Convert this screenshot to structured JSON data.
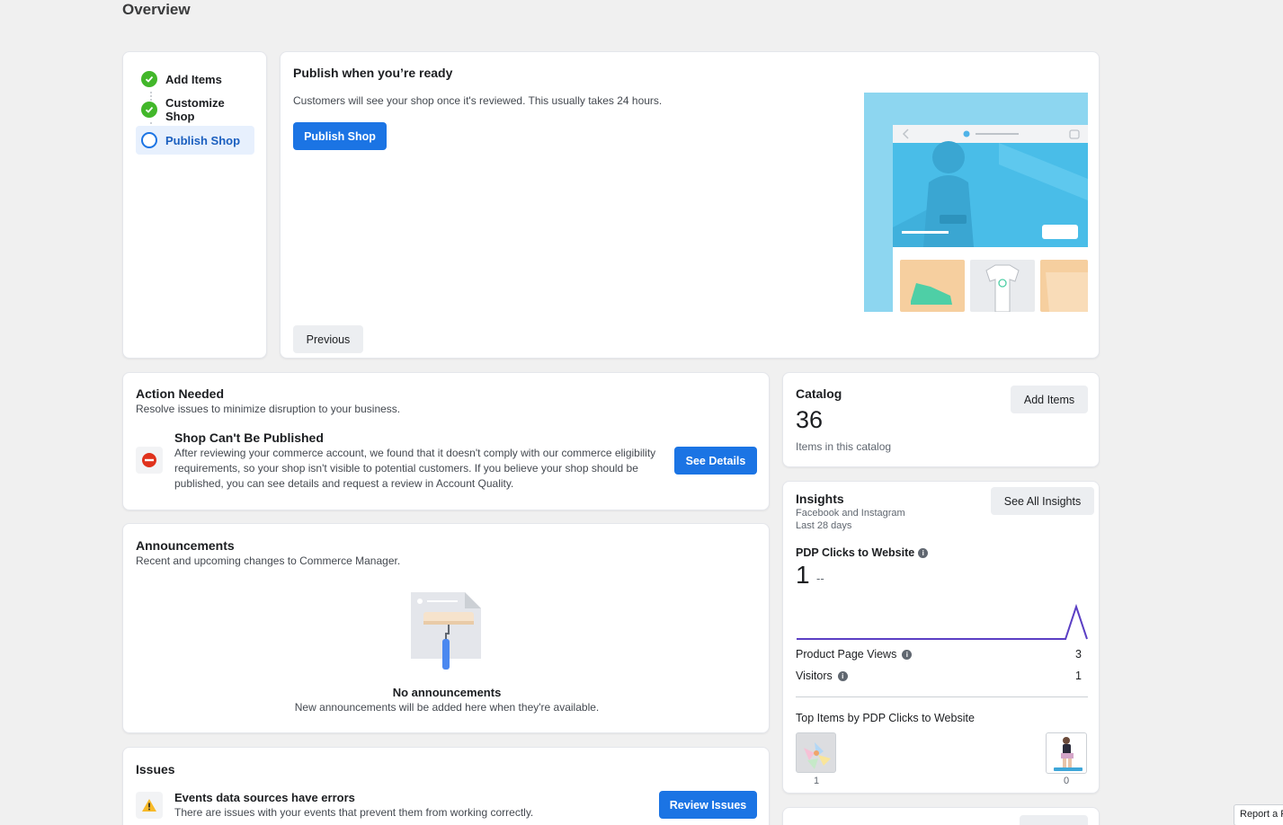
{
  "page": {
    "title": "Overview"
  },
  "steps": [
    {
      "label": "Add Items",
      "status": "done"
    },
    {
      "label": "Customize Shop",
      "status": "done"
    },
    {
      "label": "Publish Shop",
      "status": "active"
    }
  ],
  "publish": {
    "title": "Publish when you’re ready",
    "description": "Customers will see your shop once it's reviewed. This usually takes 24 hours.",
    "publish_button": "Publish Shop",
    "previous_button": "Previous"
  },
  "action_needed": {
    "title": "Action Needed",
    "subtitle": "Resolve issues to minimize disruption to your business.",
    "issue_title": "Shop Can't Be Published",
    "issue_text": "After reviewing your commerce account, we found that it doesn't comply with our commerce eligibility requirements, so your shop isn't visible to potential customers. If you believe your shop should be published, you can see details and request a review in Account Quality.",
    "button": "See Details"
  },
  "announcements": {
    "title": "Announcements",
    "subtitle": "Recent and upcoming changes to Commerce Manager.",
    "empty_title": "No announcements",
    "empty_text": "New announcements will be added here when they're available."
  },
  "issues": {
    "title": "Issues",
    "item_title": "Events data sources have errors",
    "item_text": "There are issues with your events that prevent them from working correctly.",
    "button": "Review Issues"
  },
  "catalog": {
    "title": "Catalog",
    "count": "36",
    "count_label": "Items in this catalog",
    "button": "Add Items"
  },
  "insights": {
    "title": "Insights",
    "source": "Facebook and Instagram",
    "period": "Last 28 days",
    "button": "See All Insights",
    "metric_label": "PDP Clicks to Website",
    "metric_value": "1",
    "metric_change": "--",
    "sparkline": [
      0,
      0,
      0,
      0,
      0,
      0,
      0,
      0,
      0,
      0,
      0,
      0,
      0,
      0,
      0,
      0,
      0,
      0,
      0,
      0,
      0,
      0,
      0,
      0,
      0,
      0,
      1,
      0
    ],
    "rows": [
      {
        "label": "Product Page Views",
        "value": "3"
      },
      {
        "label": "Visitors",
        "value": "1"
      }
    ],
    "top_items_title": "Top Items by PDP Clicks to Website",
    "top_items": [
      {
        "value": "1"
      },
      {
        "value": "0"
      }
    ]
  },
  "footer": {
    "report": "Report a Problem"
  },
  "colors": {
    "primary": "#1b74e4",
    "success": "#42b72a",
    "error": "#e0321c",
    "warning": "#f7b928",
    "chart_line": "#5b3fc4"
  },
  "icons": [
    "check-circle-icon",
    "empty-circle-icon",
    "error-stop-icon",
    "warning-icon",
    "info-icon"
  ]
}
